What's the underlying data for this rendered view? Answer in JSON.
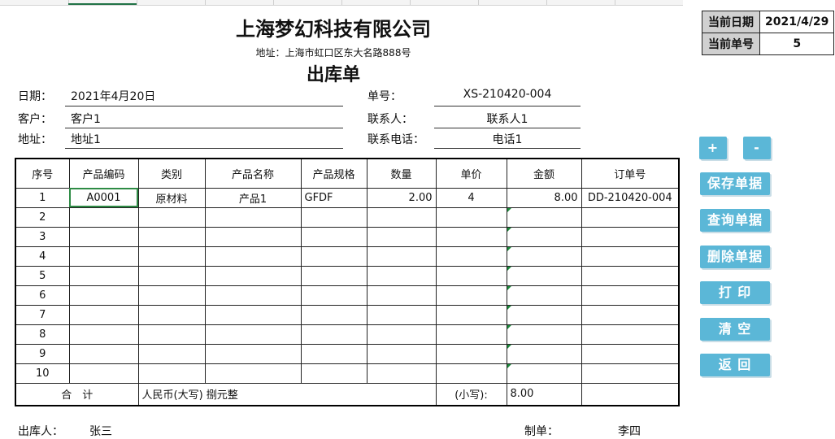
{
  "header": {
    "company": "上海梦幻科技有限公司",
    "address": "地址：上海市虹口区东大名路888号",
    "doc_title": "出库单"
  },
  "info": {
    "date_label": "日期：",
    "date_value": "2021年4月20日",
    "order_label": "单号：",
    "order_value": "XS-210420-004",
    "customer_label": "客户：",
    "customer_value": "客户1",
    "contact_label": "联系人：",
    "contact_value": "联系人1",
    "addr_label": "地址：",
    "addr_value": "地址1",
    "phone_label": "联系电话：",
    "phone_value": "电话1"
  },
  "side_info": {
    "cur_date_label": "当前日期",
    "cur_date_value": "2021/4/29",
    "cur_no_label": "当前单号",
    "cur_no_value": "5"
  },
  "buttons": {
    "plus": "+",
    "minus": "-",
    "save": "保存单据",
    "query": "查询单据",
    "delete": "删除单据",
    "print": "打 印",
    "clear": "清 空",
    "back": "返 回"
  },
  "table": {
    "headers": [
      "序号",
      "产品编码",
      "类别",
      "产品名称",
      "产品规格",
      "数量",
      "单价",
      "金额",
      "订单号"
    ],
    "rows": [
      [
        "1",
        "A0001",
        "原材料",
        "产品1",
        "GFDF",
        "2.00",
        "4",
        "8.00",
        "DD-210420-004"
      ],
      [
        "2",
        "",
        "",
        "",
        "",
        "",
        "",
        "",
        ""
      ],
      [
        "3",
        "",
        "",
        "",
        "",
        "",
        "",
        "",
        ""
      ],
      [
        "4",
        "",
        "",
        "",
        "",
        "",
        "",
        "",
        ""
      ],
      [
        "5",
        "",
        "",
        "",
        "",
        "",
        "",
        "",
        ""
      ],
      [
        "6",
        "",
        "",
        "",
        "",
        "",
        "",
        "",
        ""
      ],
      [
        "7",
        "",
        "",
        "",
        "",
        "",
        "",
        "",
        ""
      ],
      [
        "8",
        "",
        "",
        "",
        "",
        "",
        "",
        "",
        ""
      ],
      [
        "9",
        "",
        "",
        "",
        "",
        "",
        "",
        "",
        ""
      ],
      [
        "10",
        "",
        "",
        "",
        "",
        "",
        "",
        "",
        ""
      ]
    ],
    "total_label": "合　计",
    "total_upper": "人民币(大写) 捌元整",
    "total_lower_label": "(小写):",
    "total_lower_value": "8.00"
  },
  "footer": {
    "issuer_label": "出库人：",
    "issuer_value": "张三",
    "maker_label": "制单：",
    "maker_value": "李四"
  }
}
